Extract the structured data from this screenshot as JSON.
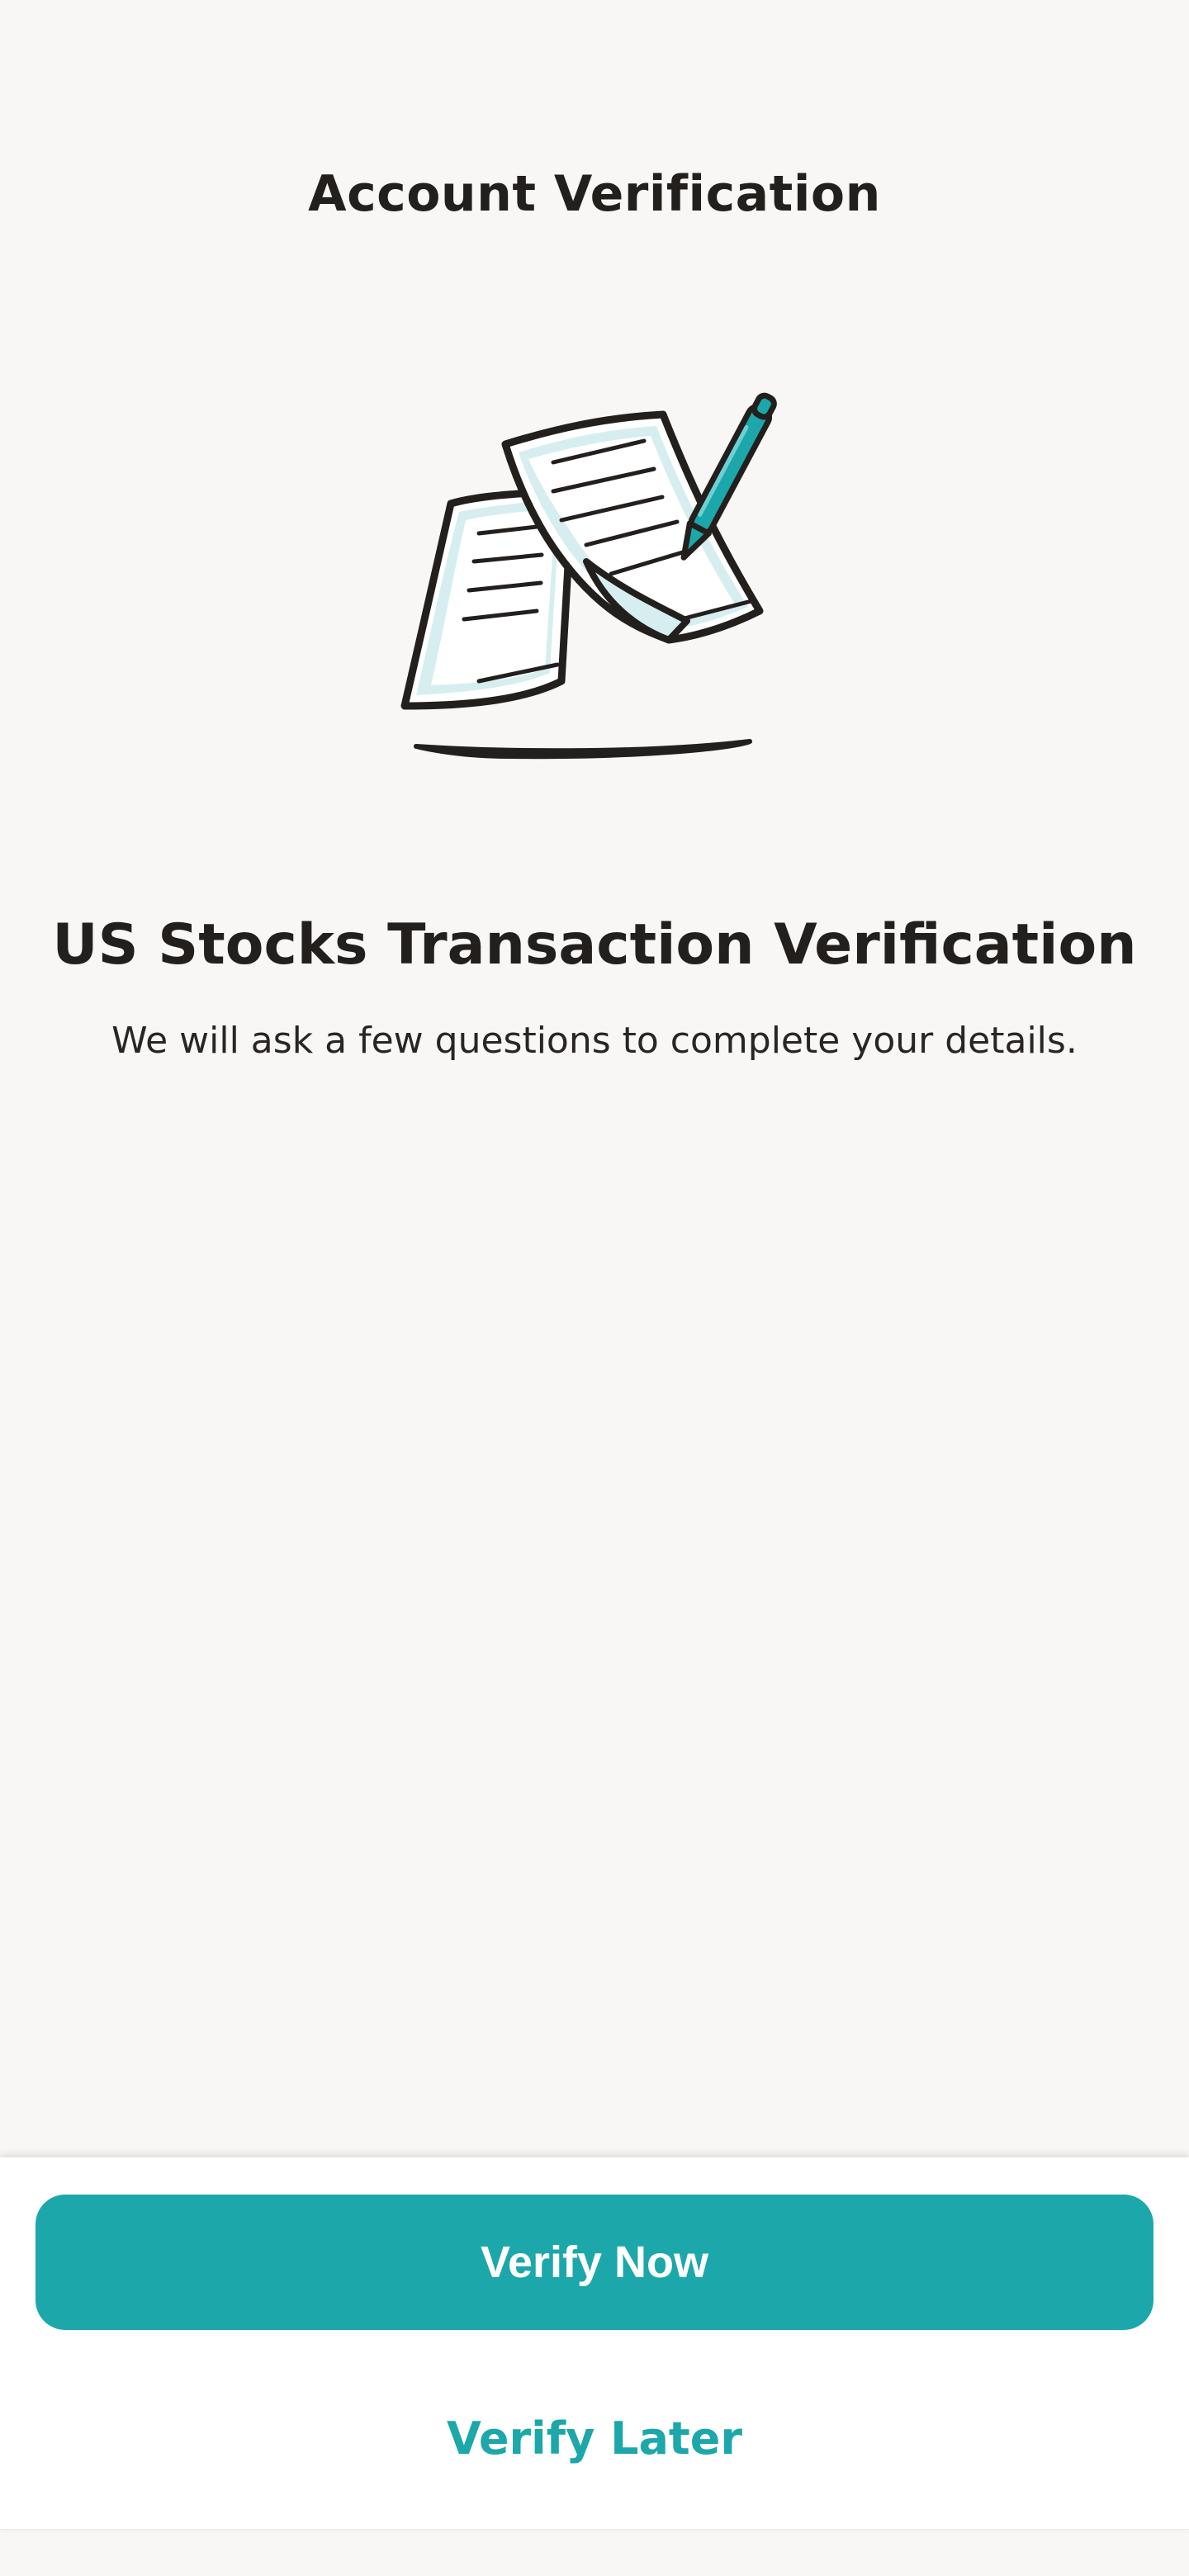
{
  "header": {
    "title": "Account Verification"
  },
  "illustration": {
    "icon": "documents-with-pen-icon",
    "colors": {
      "line": "#231f1d",
      "paper_fill": "#d6eef0",
      "pen": "#1ca7ab"
    }
  },
  "content": {
    "headline": "US Stocks Transaction Verification",
    "description": "We will ask a few questions to complete your details."
  },
  "actions": {
    "primary_label": "Verify Now",
    "secondary_label": "Verify Later"
  },
  "theme": {
    "accent": "#1ca7ab",
    "background": "#f8f7f6",
    "text": "#231f1d"
  }
}
